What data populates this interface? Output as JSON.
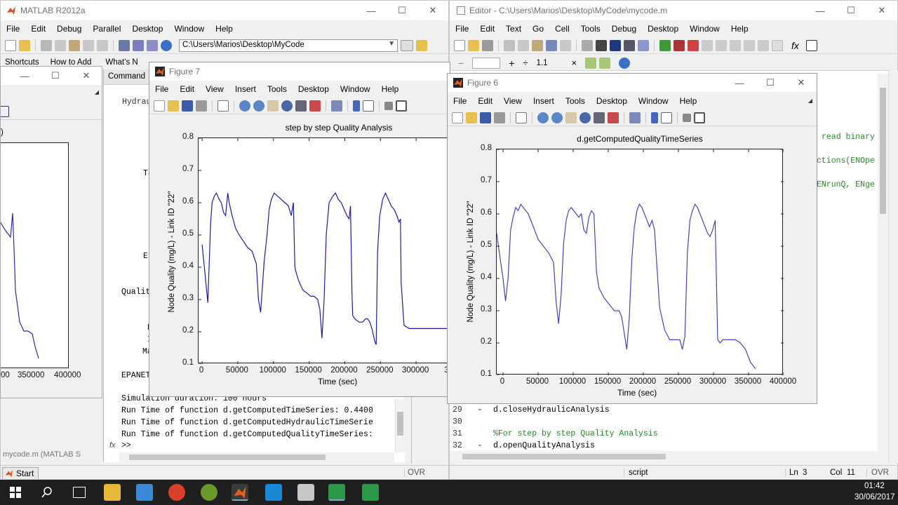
{
  "matlab": {
    "title": "MATLAB R2012a",
    "menu": [
      "File",
      "Edit",
      "Debug",
      "Parallel",
      "Desktop",
      "Window",
      "Help"
    ],
    "path": "C:\\Users\\Marios\\Desktop\\MyCode",
    "shortcuts": [
      "Shortcuts",
      "How to Add",
      "What's N"
    ],
    "command_label": "Command",
    "cmd_fragments": [
      "Hydrau",
      "Ta",
      "E",
      "Qualit",
      "N",
      "I",
      "Ma",
      "EPANET"
    ],
    "cmd_lines": [
      "Simulation duration: 100 hours",
      "Run Time of function d.getComputedTimeSeries: 0.4400",
      "Run Time of function d.getComputedHydraulicTimeSerie",
      "Run Time of function d.getComputedQualityTimeSeries:"
    ],
    "prompt": ">>",
    "fx": "fx",
    "start": "Start",
    "ovr": "OVR"
  },
  "left_window": {
    "status": "mycode.m (MATLAB S",
    "x_ticks": [
      "00",
      "350000",
      "400000"
    ],
    "y_fragment": ")"
  },
  "editor": {
    "title": "Editor - C:\\Users\\Marios\\Desktop\\MyCode\\mycode.m",
    "menu": [
      "File",
      "Edit",
      "Text",
      "Go",
      "Cell",
      "Tools",
      "Debug",
      "Desktop",
      "Window",
      "Help"
    ],
    "cell_minus": "−",
    "cell_plus": "+",
    "cell_div": "÷",
    "cell_value": "1.1",
    "cell_times": "×",
    "right_code": [
      "read binary",
      "ctions(ENOpe",
      "ENrunQ, ENge"
    ],
    "lines": [
      {
        "num": "29",
        "dash": "-",
        "text": "d.closeHydraulicAnalysis",
        "comment": false
      },
      {
        "num": "30",
        "dash": "",
        "text": "",
        "comment": false
      },
      {
        "num": "31",
        "dash": "",
        "text": "%For step by step Quality Analysis",
        "comment": true
      },
      {
        "num": "32",
        "dash": "-",
        "text": "d.openQualityAnalysis",
        "comment": false
      }
    ],
    "status_mode": "script",
    "status_ln_label": "Ln",
    "status_ln": "3",
    "status_col_label": "Col",
    "status_col": "11",
    "status_ovr": "OVR"
  },
  "figure7": {
    "title": "Figure 7",
    "menu": [
      "File",
      "Edit",
      "View",
      "Insert",
      "Tools",
      "Desktop",
      "Window",
      "Help"
    ]
  },
  "figure6": {
    "title": "Figure 6",
    "menu": [
      "File",
      "Edit",
      "View",
      "Insert",
      "Tools",
      "Desktop",
      "Window",
      "Help"
    ]
  },
  "chart_data": [
    {
      "type": "line",
      "title": "step by step Quality Analysis",
      "xlabel": "Time (sec)",
      "ylabel": "Node Quality (mg/L) - Link ID \"22\"",
      "xlim": [
        -5000,
        350000
      ],
      "ylim": [
        0.1,
        0.8
      ],
      "x_ticks": [
        "0",
        "50000",
        "100000",
        "150000",
        "200000",
        "250000",
        "300000",
        "350"
      ],
      "y_ticks": [
        "0.1",
        "0.2",
        "0.3",
        "0.4",
        "0.5",
        "0.6",
        "0.7",
        "0.8"
      ],
      "grid": false,
      "color": "#1c1ca8",
      "series": [
        {
          "x": [
            0,
            4000,
            8000,
            12000,
            14000,
            17000,
            20000,
            24000,
            27000,
            30000,
            33000,
            36000,
            38000,
            42000,
            47000,
            52000,
            58000,
            64000,
            70000,
            76000,
            79000,
            82000,
            87000,
            91000,
            94000,
            97000,
            101000,
            106000,
            111000,
            116000,
            121000,
            125000,
            128000,
            130000,
            131000,
            135000,
            141000,
            147000,
            152000,
            157000,
            162000,
            165000,
            168000,
            171000,
            174000,
            178000,
            183000,
            187000,
            191000,
            195000,
            199000,
            203000,
            206000,
            208000,
            210000,
            211000,
            214000,
            220000,
            225000,
            229000,
            232000,
            235000,
            238000,
            242000,
            244000,
            246000,
            249000,
            253000,
            257000,
            261000,
            265000,
            269000,
            273000,
            276000,
            278000,
            279000,
            283000,
            290000,
            297000,
            303000,
            310000,
            317000,
            324000,
            330000,
            336000,
            342000,
            346000,
            350000
          ],
          "y": [
            0.47,
            0.38,
            0.29,
            0.54,
            0.6,
            0.62,
            0.63,
            0.61,
            0.6,
            0.57,
            0.56,
            0.63,
            0.6,
            0.56,
            0.52,
            0.5,
            0.48,
            0.46,
            0.45,
            0.41,
            0.3,
            0.26,
            0.42,
            0.5,
            0.58,
            0.61,
            0.63,
            0.62,
            0.61,
            0.6,
            0.59,
            0.56,
            0.6,
            0.4,
            0.39,
            0.36,
            0.33,
            0.32,
            0.31,
            0.31,
            0.3,
            0.27,
            0.18,
            0.3,
            0.5,
            0.6,
            0.62,
            0.63,
            0.61,
            0.6,
            0.58,
            0.56,
            0.55,
            0.59,
            0.33,
            0.25,
            0.24,
            0.23,
            0.23,
            0.24,
            0.24,
            0.23,
            0.21,
            0.17,
            0.16,
            0.45,
            0.56,
            0.61,
            0.63,
            0.61,
            0.59,
            0.58,
            0.56,
            0.54,
            0.55,
            0.35,
            0.22,
            0.21,
            0.21,
            0.21,
            0.21,
            0.21,
            0.21,
            0.21,
            0.21,
            0.21,
            0.21,
            0.21
          ]
        }
      ]
    },
    {
      "type": "line",
      "title": "d.getComputedQualityTimeSeries",
      "xlabel": "Time (sec)",
      "ylabel": "Node Quality (mg/L) - Link ID \"22\"",
      "xlim": [
        -9000,
        400000
      ],
      "ylim": [
        0.1,
        0.8
      ],
      "x_ticks": [
        "0",
        "50000",
        "100000",
        "150000",
        "200000",
        "250000",
        "300000",
        "350000",
        "400000"
      ],
      "y_ticks": [
        "0.1",
        "0.2",
        "0.3",
        "0.4",
        "0.5",
        "0.6",
        "0.7",
        "0.8"
      ],
      "grid": false,
      "color": "#4444c4",
      "series": [
        {
          "x": [
            -9000,
            -4000,
            0,
            3600,
            7200,
            10800,
            14400,
            18000,
            21600,
            25200,
            28800,
            32400,
            36000,
            43200,
            50400,
            57600,
            64800,
            72000,
            75600,
            79200,
            82800,
            86400,
            90000,
            93600,
            97200,
            100800,
            104400,
            108000,
            111600,
            115200,
            118800,
            122400,
            126000,
            129600,
            133200,
            136800,
            144000,
            151200,
            158400,
            165600,
            169200,
            172800,
            176400,
            180000,
            183600,
            187200,
            190800,
            194400,
            198000,
            201600,
            205200,
            208800,
            212400,
            216000,
            223200,
            230400,
            237600,
            244800,
            248400,
            252000,
            255600,
            259200,
            262800,
            266400,
            270000,
            273600,
            277200,
            280800,
            284400,
            288000,
            291600,
            295200,
            298800,
            302400,
            306000,
            309600,
            313200,
            316800,
            320400,
            324000,
            327600,
            331200,
            338400,
            345600,
            352800,
            356400,
            360000
          ],
          "y": [
            0.54,
            0.46,
            0.4,
            0.33,
            0.4,
            0.55,
            0.59,
            0.62,
            0.61,
            0.63,
            0.62,
            0.61,
            0.6,
            0.56,
            0.52,
            0.5,
            0.48,
            0.45,
            0.33,
            0.26,
            0.35,
            0.51,
            0.58,
            0.61,
            0.62,
            0.61,
            0.6,
            0.59,
            0.6,
            0.55,
            0.54,
            0.59,
            0.61,
            0.6,
            0.42,
            0.37,
            0.34,
            0.32,
            0.3,
            0.3,
            0.28,
            0.23,
            0.18,
            0.28,
            0.46,
            0.56,
            0.61,
            0.63,
            0.62,
            0.6,
            0.58,
            0.56,
            0.58,
            0.55,
            0.31,
            0.24,
            0.21,
            0.21,
            0.21,
            0.21,
            0.18,
            0.22,
            0.48,
            0.58,
            0.61,
            0.63,
            0.62,
            0.6,
            0.58,
            0.56,
            0.54,
            0.53,
            0.55,
            0.58,
            0.21,
            0.2,
            0.21,
            0.21,
            0.21,
            0.21,
            0.21,
            0.21,
            0.2,
            0.18,
            0.14,
            0.13,
            0.12
          ]
        }
      ]
    }
  ],
  "taskbar": {
    "time": "01:42",
    "date": "30/06/2017",
    "accent": "#2b2b2b"
  }
}
